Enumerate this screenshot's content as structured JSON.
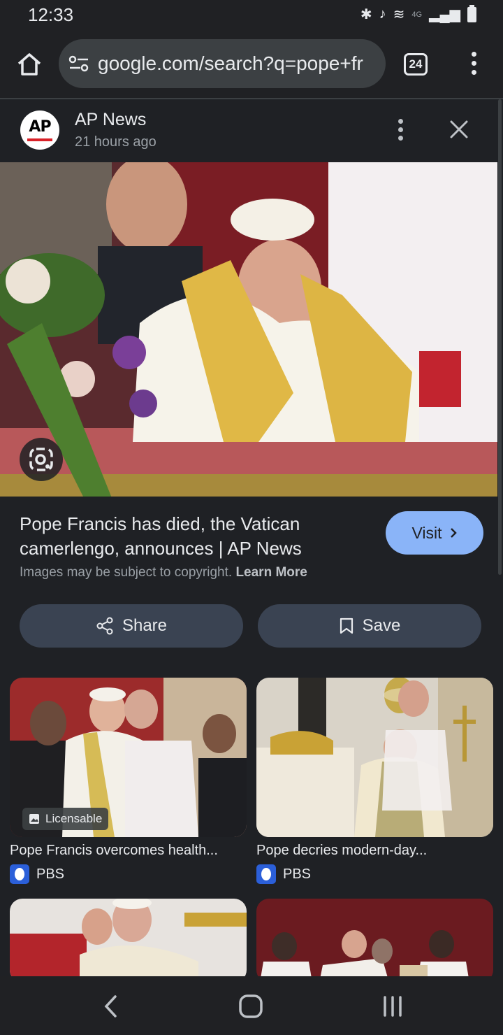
{
  "status_bar": {
    "time": "12:33",
    "icons": [
      "bluetooth-icon",
      "mute-icon",
      "wifi-icon",
      "signal-icon",
      "battery-icon"
    ],
    "network": "4G"
  },
  "browser": {
    "url": "google.com/search?q=pope+fr",
    "tab_count": "24"
  },
  "source": {
    "name": "AP News",
    "time_ago": "21 hours ago",
    "logo_text": "AP"
  },
  "result": {
    "title": "Pope Francis has died, the Vatican camerlengo, announces | AP News",
    "copyright": "Images may be subject to copyright.",
    "learn_more": "Learn More",
    "visit_label": "Visit",
    "share_label": "Share",
    "save_label": "Save"
  },
  "related": [
    {
      "title": "Pope Francis overcomes health...",
      "source": "PBS",
      "badge": "Licensable"
    },
    {
      "title": "Pope decries modern-day...",
      "source": "PBS"
    }
  ],
  "colors": {
    "accent": "#8ab4f8",
    "background": "#1f2125",
    "button": "#3a4352"
  }
}
